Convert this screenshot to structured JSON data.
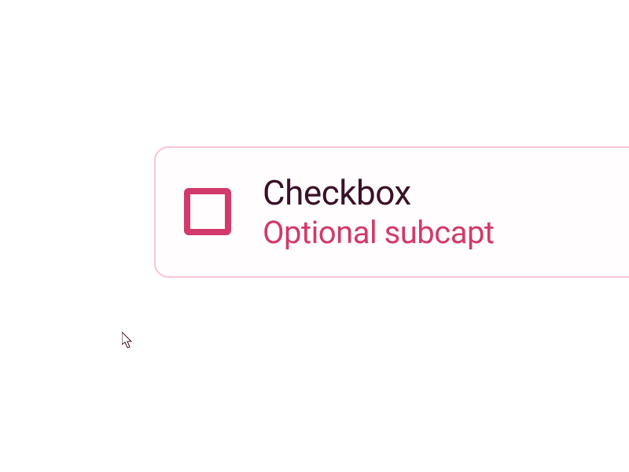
{
  "checkbox": {
    "label": "Checkbox",
    "subcaption": "Optional subcapt",
    "checked": false
  },
  "colors": {
    "border": "#f5c6d4",
    "accent": "#d13a6a",
    "label": "#3a1128"
  }
}
